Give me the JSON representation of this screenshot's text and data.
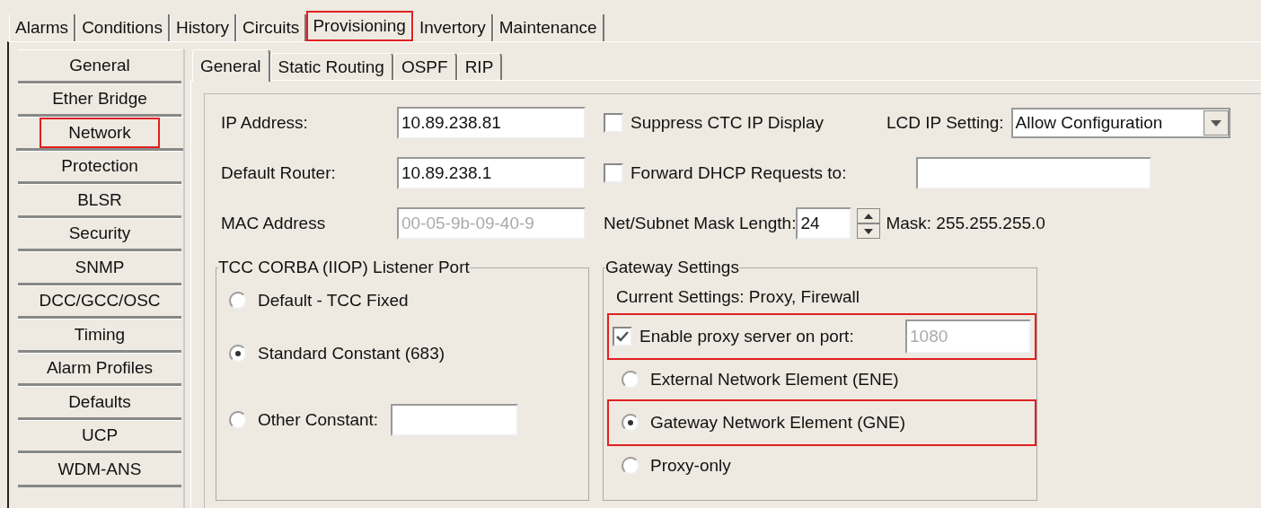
{
  "main_tabs": [
    {
      "label": "Alarms",
      "selected": false,
      "highlighted": false
    },
    {
      "label": "Conditions",
      "selected": false,
      "highlighted": false
    },
    {
      "label": "History",
      "selected": false,
      "highlighted": false
    },
    {
      "label": "Circuits",
      "selected": false,
      "highlighted": false
    },
    {
      "label": "Provisioning",
      "selected": true,
      "highlighted": true
    },
    {
      "label": "Invertory",
      "selected": false,
      "highlighted": false
    },
    {
      "label": "Maintenance",
      "selected": false,
      "highlighted": false
    }
  ],
  "sidebar": {
    "items": [
      {
        "label": "General",
        "selected": false,
        "highlighted": false
      },
      {
        "label": "Ether Bridge",
        "selected": false,
        "highlighted": false
      },
      {
        "label": "Network",
        "selected": true,
        "highlighted": true
      },
      {
        "label": "Protection",
        "selected": false,
        "highlighted": false
      },
      {
        "label": "BLSR",
        "selected": false,
        "highlighted": false
      },
      {
        "label": "Security",
        "selected": false,
        "highlighted": false
      },
      {
        "label": "SNMP",
        "selected": false,
        "highlighted": false
      },
      {
        "label": "DCC/GCC/OSC",
        "selected": false,
        "highlighted": false
      },
      {
        "label": "Timing",
        "selected": false,
        "highlighted": false
      },
      {
        "label": "Alarm Profiles",
        "selected": false,
        "highlighted": false
      },
      {
        "label": "Defaults",
        "selected": false,
        "highlighted": false
      },
      {
        "label": "UCP",
        "selected": false,
        "highlighted": false
      },
      {
        "label": "WDM-ANS",
        "selected": false,
        "highlighted": false
      }
    ]
  },
  "sub_tabs": [
    {
      "label": "General",
      "selected": true
    },
    {
      "label": "Static Routing",
      "selected": false
    },
    {
      "label": "OSPF",
      "selected": false
    },
    {
      "label": "RIP",
      "selected": false
    }
  ],
  "form": {
    "ip_address": {
      "label": "IP Address:",
      "value": "10.89.238.81",
      "disabled": false
    },
    "suppress_ctc": {
      "label": "Suppress CTC IP Display",
      "checked": false
    },
    "lcd_ip_setting": {
      "label": "LCD IP Setting:",
      "value": "Allow Configuration"
    },
    "default_router": {
      "label": "Default Router:",
      "value": "10.89.238.1",
      "disabled": false
    },
    "forward_dhcp": {
      "label": "Forward DHCP Requests to:",
      "checked": false
    },
    "mac_address": {
      "label": "MAC Address",
      "value": "00-05-9b-09-40-9",
      "disabled": true
    },
    "mask_length": {
      "label": "Net/Subnet Mask Length:",
      "value": "24"
    },
    "mask": "Mask: 255.255.255.0"
  },
  "listener_port": {
    "title": "TCC CORBA (IIOP) Listener Port",
    "options": [
      {
        "kind": "plain",
        "label": "Default - TCC Fixed",
        "selected": false
      },
      {
        "kind": "plain",
        "label": "Standard Constant (683)",
        "selected": true
      },
      {
        "kind": "field",
        "label": "Other Constant:",
        "selected": false
      }
    ]
  },
  "gateway": {
    "title": "Gateway Settings",
    "current": "Current Settings: Proxy, Firewall",
    "proxy": {
      "label": "Enable proxy server on port:",
      "checked": true,
      "port": "1080",
      "disabled": true,
      "highlighted": true
    },
    "options": [
      {
        "label": "External Network Element (ENE)",
        "selected": false,
        "highlighted": false
      },
      {
        "label": "Gateway Network Element (GNE)",
        "selected": true,
        "highlighted": true
      },
      {
        "label": "Proxy-only",
        "selected": false,
        "highlighted": false
      }
    ]
  }
}
